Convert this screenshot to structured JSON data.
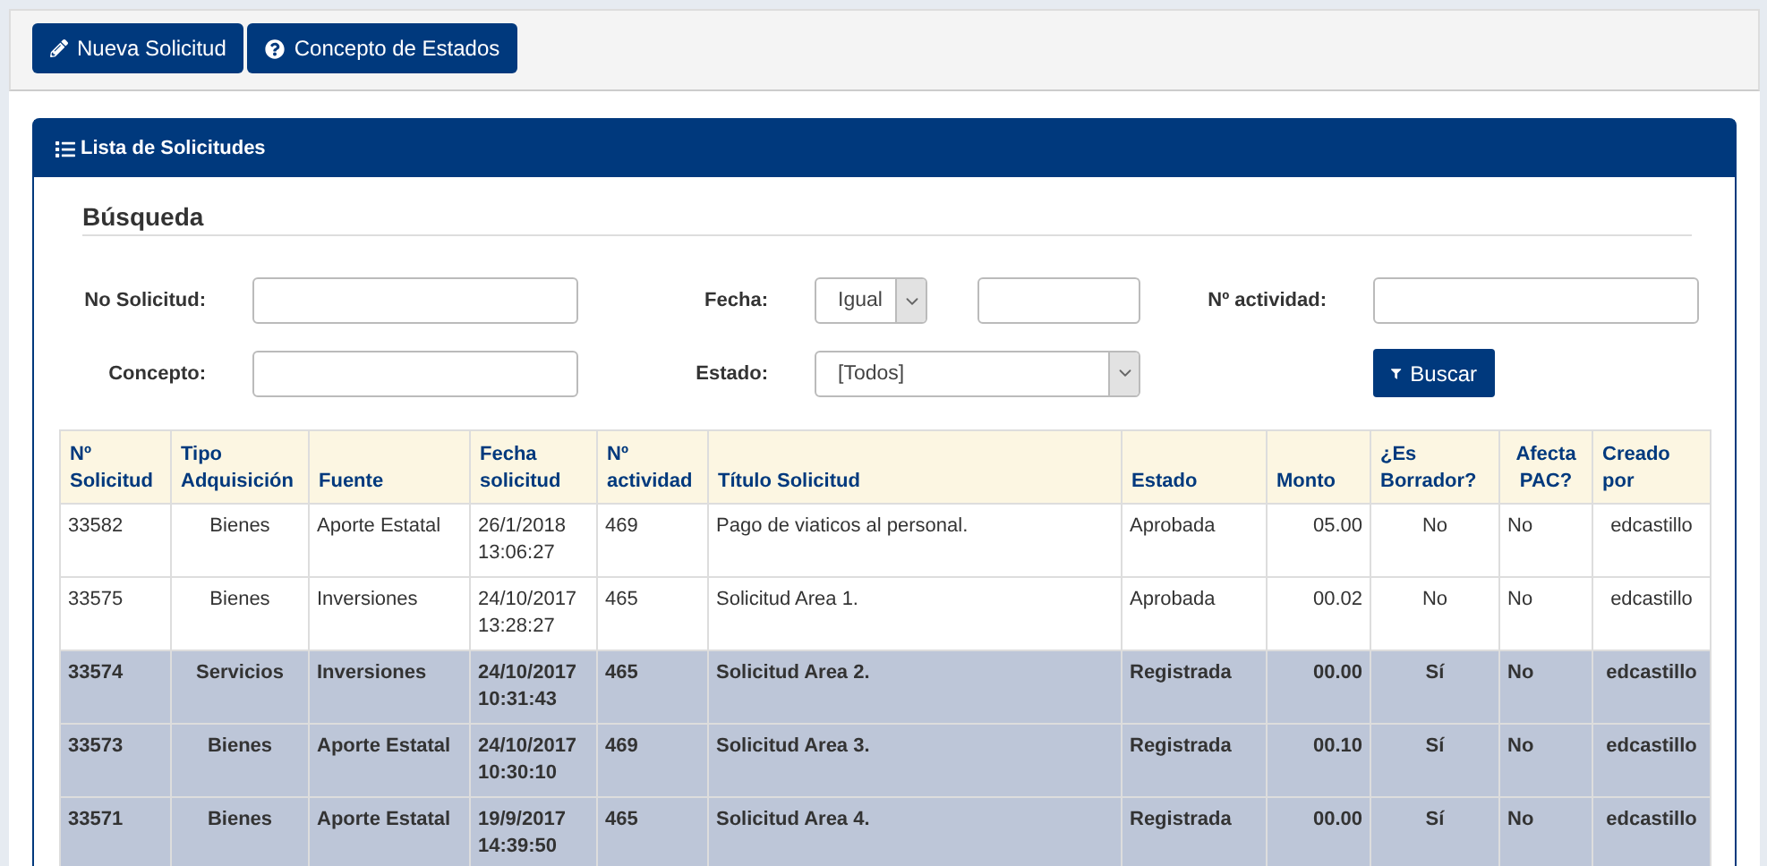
{
  "toolbar": {
    "buttons": [
      {
        "kind": "edit",
        "label": "Nueva Solicitud"
      },
      {
        "kind": "help",
        "label": "Concepto de Estados"
      }
    ]
  },
  "panel": {
    "title": "Lista de Solicitudes",
    "search": {
      "heading": "Búsqueda",
      "no_solicitud": {
        "label": "No Solicitud:"
      },
      "fecha": {
        "label": "Fecha:",
        "operator": "Igual"
      },
      "actividad": {
        "label": "Nº actividad:"
      },
      "concepto": {
        "label": "Concepto:"
      },
      "estado": {
        "label": "Estado:",
        "value": "[Todos]"
      },
      "button": "Buscar"
    },
    "table": {
      "columns": [
        "Nº Solicitud",
        "Tipo Adquisición",
        "Fuente",
        "Fecha solicitud",
        "Nº actividad",
        "Título Solicitud",
        "Estado",
        "Monto",
        "¿Es Borrador?",
        "Afecta PAC?",
        "Creado por"
      ],
      "rows": [
        {
          "highlighted": false,
          "cells": [
            "33582",
            "Bienes",
            "Aporte Estatal",
            "26/1/2018 13:06:27",
            "469",
            "Pago de viaticos al personal.",
            "Aprobada",
            "05.00",
            "No",
            "No",
            "edcastillo"
          ]
        },
        {
          "highlighted": false,
          "cells": [
            "33575",
            "Bienes",
            "Inversiones",
            "24/10/2017 13:28:27",
            "465",
            "Solicitud Area 1.",
            "Aprobada",
            "00.02",
            "No",
            "No",
            "edcastillo"
          ]
        },
        {
          "highlighted": true,
          "cells": [
            "33574",
            "Servicios",
            "Inversiones",
            "24/10/2017 10:31:43",
            "465",
            "Solicitud Area 2.",
            "Registrada",
            "00.00",
            "Sí",
            "No",
            "edcastillo"
          ]
        },
        {
          "highlighted": true,
          "cells": [
            "33573",
            "Bienes",
            "Aporte Estatal",
            "24/10/2017 10:30:10",
            "469",
            "Solicitud Area 3.",
            "Registrada",
            "00.10",
            "Sí",
            "No",
            "edcastillo"
          ]
        },
        {
          "highlighted": true,
          "cells": [
            "33571",
            "Bienes",
            "Aporte Estatal",
            "19/9/2017 14:39:50",
            "465",
            "Solicitud Area 4.",
            "Registrada",
            "00.00",
            "Sí",
            "No",
            "edcastillo"
          ]
        }
      ]
    }
  }
}
